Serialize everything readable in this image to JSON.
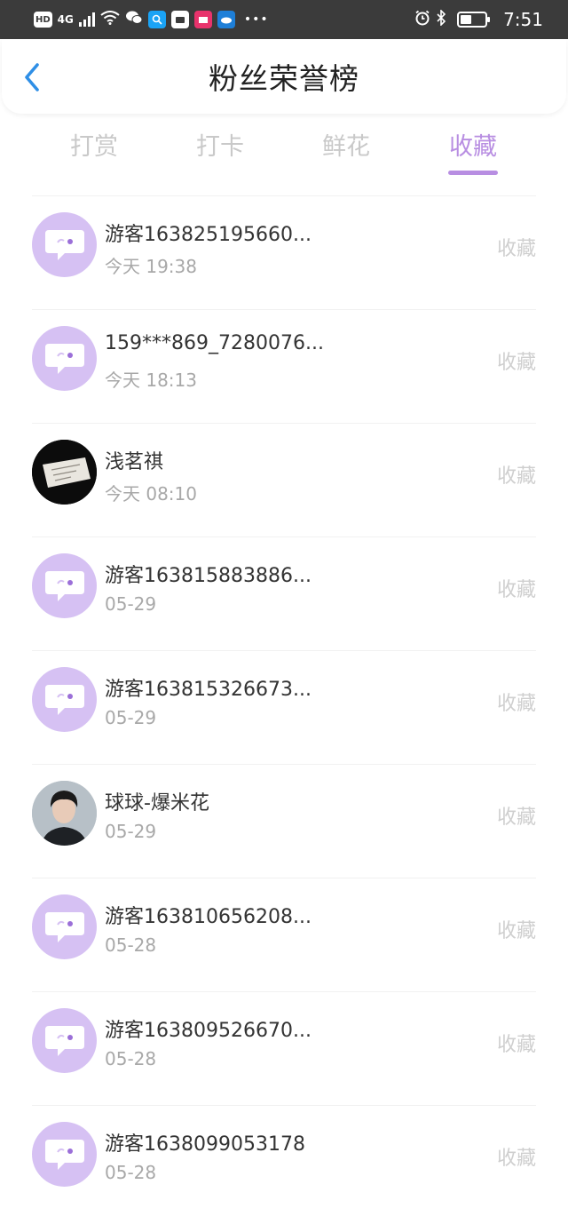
{
  "status_bar": {
    "hd_label": "HD",
    "network_label": "4G",
    "time": "7:51",
    "more_label": "•••"
  },
  "header": {
    "title": "粉丝荣誉榜",
    "back_icon": "chevron-left-icon"
  },
  "tabs": [
    {
      "label": "打赏",
      "active": false
    },
    {
      "label": "打卡",
      "active": false
    },
    {
      "label": "鲜花",
      "active": false
    },
    {
      "label": "收藏",
      "active": true
    }
  ],
  "colors": {
    "accent": "#b88ee2",
    "avatar_bg": "#d6c1f3",
    "inactive_tab": "#c9c9c9",
    "action_text": "#cfcfcf"
  },
  "fans": [
    {
      "name": "游客163825195660...",
      "time": "今天 19:38",
      "action": "收藏",
      "avatar": "default-chat-icon"
    },
    {
      "name": "159***869_7280076...",
      "time": "今天 18:13",
      "action": "收藏",
      "avatar": "default-chat-icon"
    },
    {
      "name": "浅茗祺",
      "time": "今天 08:10",
      "action": "收藏",
      "avatar": "photo-paper-note"
    },
    {
      "name": "游客163815883886...",
      "time": "05-29",
      "action": "收藏",
      "avatar": "default-chat-icon"
    },
    {
      "name": "游客163815326673...",
      "time": "05-29",
      "action": "收藏",
      "avatar": "default-chat-icon"
    },
    {
      "name": "球球-爆米花",
      "time": "05-29",
      "action": "收藏",
      "avatar": "photo-person"
    },
    {
      "name": "游客163810656208...",
      "time": "05-28",
      "action": "收藏",
      "avatar": "default-chat-icon"
    },
    {
      "name": "游客163809526670...",
      "time": "05-28",
      "action": "收藏",
      "avatar": "default-chat-icon"
    },
    {
      "name": "游客1638099053178",
      "time": "05-28",
      "action": "收藏",
      "avatar": "default-chat-icon"
    }
  ]
}
